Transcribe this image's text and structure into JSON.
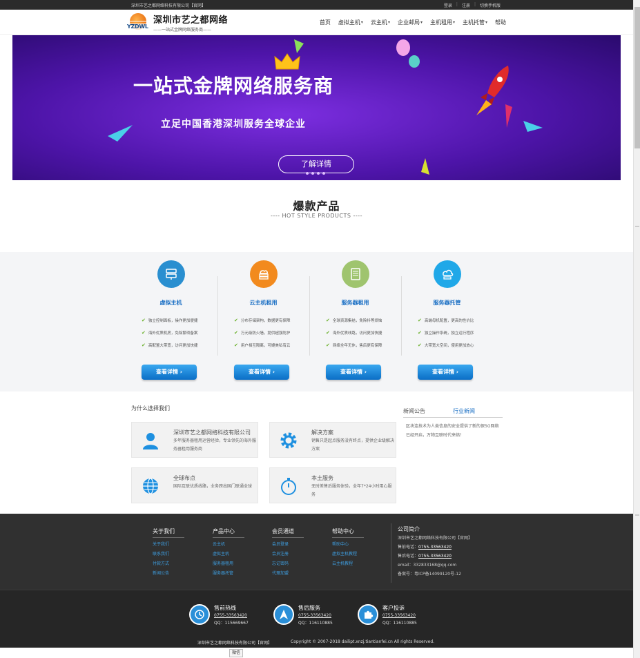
{
  "topbar": {
    "company": "深圳市艺之都网络科技有限公司【官网】",
    "links": [
      "登录",
      "注册",
      "切换手机版"
    ]
  },
  "header": {
    "logo_mark": "YZDWL",
    "logo_title": "深圳市艺之都网络",
    "logo_sub": "——一站式金牌网络服务商——",
    "nav": [
      {
        "label": "首页",
        "caret": false
      },
      {
        "label": "虚拟主机",
        "caret": true
      },
      {
        "label": "云主机",
        "caret": true
      },
      {
        "label": "企业邮局",
        "caret": true
      },
      {
        "label": "主机租用",
        "caret": true
      },
      {
        "label": "主机托管",
        "caret": true
      },
      {
        "label": "帮助",
        "caret": false
      }
    ]
  },
  "banner": {
    "title": "一站式金牌网络服务商",
    "subtitle": "立足中国香港深圳服务全球企业",
    "button": "了解详情"
  },
  "hot": {
    "title": "爆款产品",
    "subtitle": "----  HOT STYLE PRODUCTS  ----"
  },
  "products": [
    {
      "name": "虚拟主机",
      "color": "#2a8fd0",
      "icon": "server-icon",
      "features": [
        "独立控制面板，操作更加便捷",
        "海外优质机房，免除繁琐备案",
        "高配置大带宽，访问更加快捷"
      ],
      "button": "查看详情"
    },
    {
      "name": "云主机租用",
      "color": "#f28a1e",
      "icon": "cloud-stack-icon",
      "features": [
        "分布存储架构，数据更有保障",
        "万元级防火墙，提供超强防护",
        "用户相互隔离，可媲美私有云"
      ],
      "button": "查看详情"
    },
    {
      "name": "服务器租用",
      "color": "#9fc46e",
      "icon": "rack-server-icon",
      "features": [
        "全球资源集结，免除抖等烦恼",
        "海外优质线路，访问更加快捷",
        "网络全年无休，售后更有保障"
      ],
      "button": "查看详情"
    },
    {
      "name": "服务器托管",
      "color": "#20a8e8",
      "icon": "cloud-server-icon",
      "features": [
        "高端母机配置，更高的性价比",
        "独立操作系统，独立运行程序",
        "大带宽大空间，使用更加放心"
      ],
      "button": "查看详情"
    }
  ],
  "why": {
    "title": "为什么选择我们",
    "cards": [
      {
        "title": "深圳市艺之都网络科技有限公司",
        "desc": "多年服务器租用运营经验，专业领先的海外服务器租用服务商",
        "icon": "user-icon"
      },
      {
        "title": "解决方案",
        "desc": "销售只是起点服务没有终点，提供企业级解决方案",
        "icon": "gear-icon"
      },
      {
        "title": "全球布点",
        "desc": "国际互联优质线路，业务跨出国门联通全球",
        "icon": "globe-icon"
      },
      {
        "title": "本土服务",
        "desc": "无时差售后服务体验，全年7*24小时用心服务",
        "icon": "stopwatch-icon"
      }
    ]
  },
  "news": {
    "tabs": [
      "新闻公告",
      "行业新闻"
    ],
    "body": "区块连技术为人类信息的安全提供了新的保5G网络已经开启，万物互联时代来临！"
  },
  "footer": {
    "columns": [
      {
        "title": "关于我们",
        "items": [
          "关于我们",
          "联系我们",
          "付款方式",
          "新闻公告"
        ]
      },
      {
        "title": "产品中心",
        "items": [
          "云主机",
          "虚拟主机",
          "服务器租用",
          "服务器托管"
        ]
      },
      {
        "title": "会员通道",
        "items": [
          "会员登录",
          "会员注册",
          "忘记密码",
          "代理加盟"
        ]
      },
      {
        "title": "帮助中心",
        "items": [
          "帮助中心",
          "虚拟主机教程",
          "云主机教程"
        ]
      }
    ],
    "about": {
      "title": "公司简介",
      "company": "深圳市艺之都网络科技有限公司【官网】",
      "presale_label": "售前电话：",
      "presale": "0755-33563420",
      "aftersale_label": "售后电话：",
      "aftersale": "0755-33563420",
      "email": "email：332833168@qq.com",
      "icp": "备案号：粤ICP备14099120号-12"
    }
  },
  "contact": [
    {
      "title": "售前热线",
      "tel": "0755-33563420",
      "qq": "QQ：115669667",
      "icon": "clock-icon"
    },
    {
      "title": "售后服务",
      "tel": "0755-33563420",
      "qq": "QQ：116110885",
      "icon": "navigation-arrow-icon"
    },
    {
      "title": "客户投诉",
      "tel": "0755-33563420",
      "qq": "QQ：116110885",
      "icon": "puzzle-icon"
    }
  ],
  "copyright": {
    "company": "深圳市艺之都网络科技有限公司【官网】",
    "text": "Copyright © 2007-2018 dailipt.xnzj.tiantianfei.cn All rights Reserved."
  },
  "wechat": "微信"
}
